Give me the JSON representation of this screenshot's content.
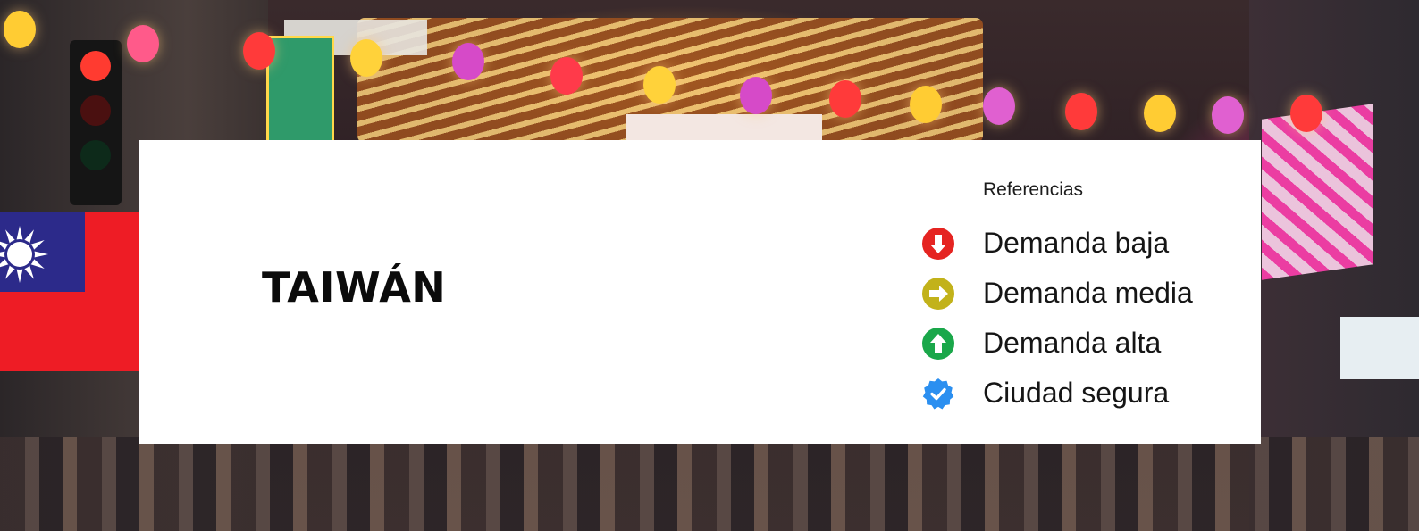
{
  "country": {
    "name": "TAIWÁN"
  },
  "legend": {
    "title": "Referencias",
    "items": [
      {
        "label": "Demanda baja",
        "icon": "down-arrow-circle-icon",
        "color": "#e52421"
      },
      {
        "label": "Demanda media",
        "icon": "right-arrow-circle-icon",
        "color": "#c2b21a"
      },
      {
        "label": "Demanda alta",
        "icon": "up-arrow-circle-icon",
        "color": "#1aa74a"
      },
      {
        "label": "Ciudad segura",
        "icon": "verified-badge-icon",
        "color": "#2b8ff0"
      }
    ]
  },
  "flag": {
    "icon": "taiwan-flag-icon",
    "red": "#ee1c25",
    "blue": "#2c2a8a"
  }
}
